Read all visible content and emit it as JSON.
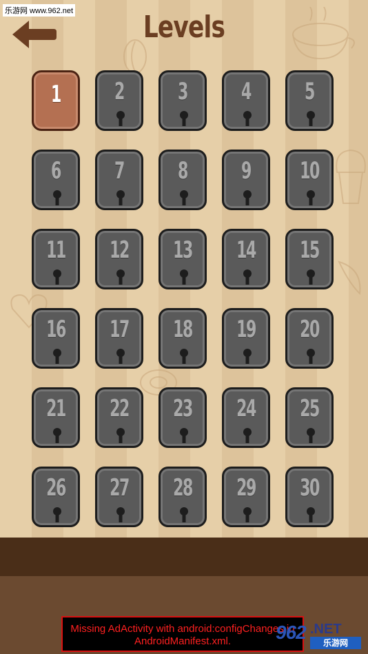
{
  "watermark": "乐游网 www.962.net",
  "header": {
    "title": "Levels",
    "back_icon": "back-arrow-icon"
  },
  "levels": [
    {
      "number": "1",
      "locked": false
    },
    {
      "number": "2",
      "locked": true
    },
    {
      "number": "3",
      "locked": true
    },
    {
      "number": "4",
      "locked": true
    },
    {
      "number": "5",
      "locked": true
    },
    {
      "number": "6",
      "locked": true
    },
    {
      "number": "7",
      "locked": true
    },
    {
      "number": "8",
      "locked": true
    },
    {
      "number": "9",
      "locked": true
    },
    {
      "number": "10",
      "locked": true
    },
    {
      "number": "11",
      "locked": true
    },
    {
      "number": "12",
      "locked": true
    },
    {
      "number": "13",
      "locked": true
    },
    {
      "number": "14",
      "locked": true
    },
    {
      "number": "15",
      "locked": true
    },
    {
      "number": "16",
      "locked": true
    },
    {
      "number": "17",
      "locked": true
    },
    {
      "number": "18",
      "locked": true
    },
    {
      "number": "19",
      "locked": true
    },
    {
      "number": "20",
      "locked": true
    },
    {
      "number": "21",
      "locked": true
    },
    {
      "number": "22",
      "locked": true
    },
    {
      "number": "23",
      "locked": true
    },
    {
      "number": "24",
      "locked": true
    },
    {
      "number": "25",
      "locked": true
    },
    {
      "number": "26",
      "locked": true
    },
    {
      "number": "27",
      "locked": true
    },
    {
      "number": "28",
      "locked": true
    },
    {
      "number": "29",
      "locked": true
    },
    {
      "number": "30",
      "locked": true
    }
  ],
  "ad_error": {
    "line1": "Missing AdActivity with android:configChanges in",
    "line2": "AndroidManifest.xml."
  },
  "badge": {
    "main": "962",
    "top": ".NET",
    "bottom": "乐游网"
  },
  "colors": {
    "title": "#6b3e22",
    "unlocked_tile": "#b47052",
    "locked_tile": "#5a5a5a",
    "ad_error_text": "#ff2020"
  }
}
